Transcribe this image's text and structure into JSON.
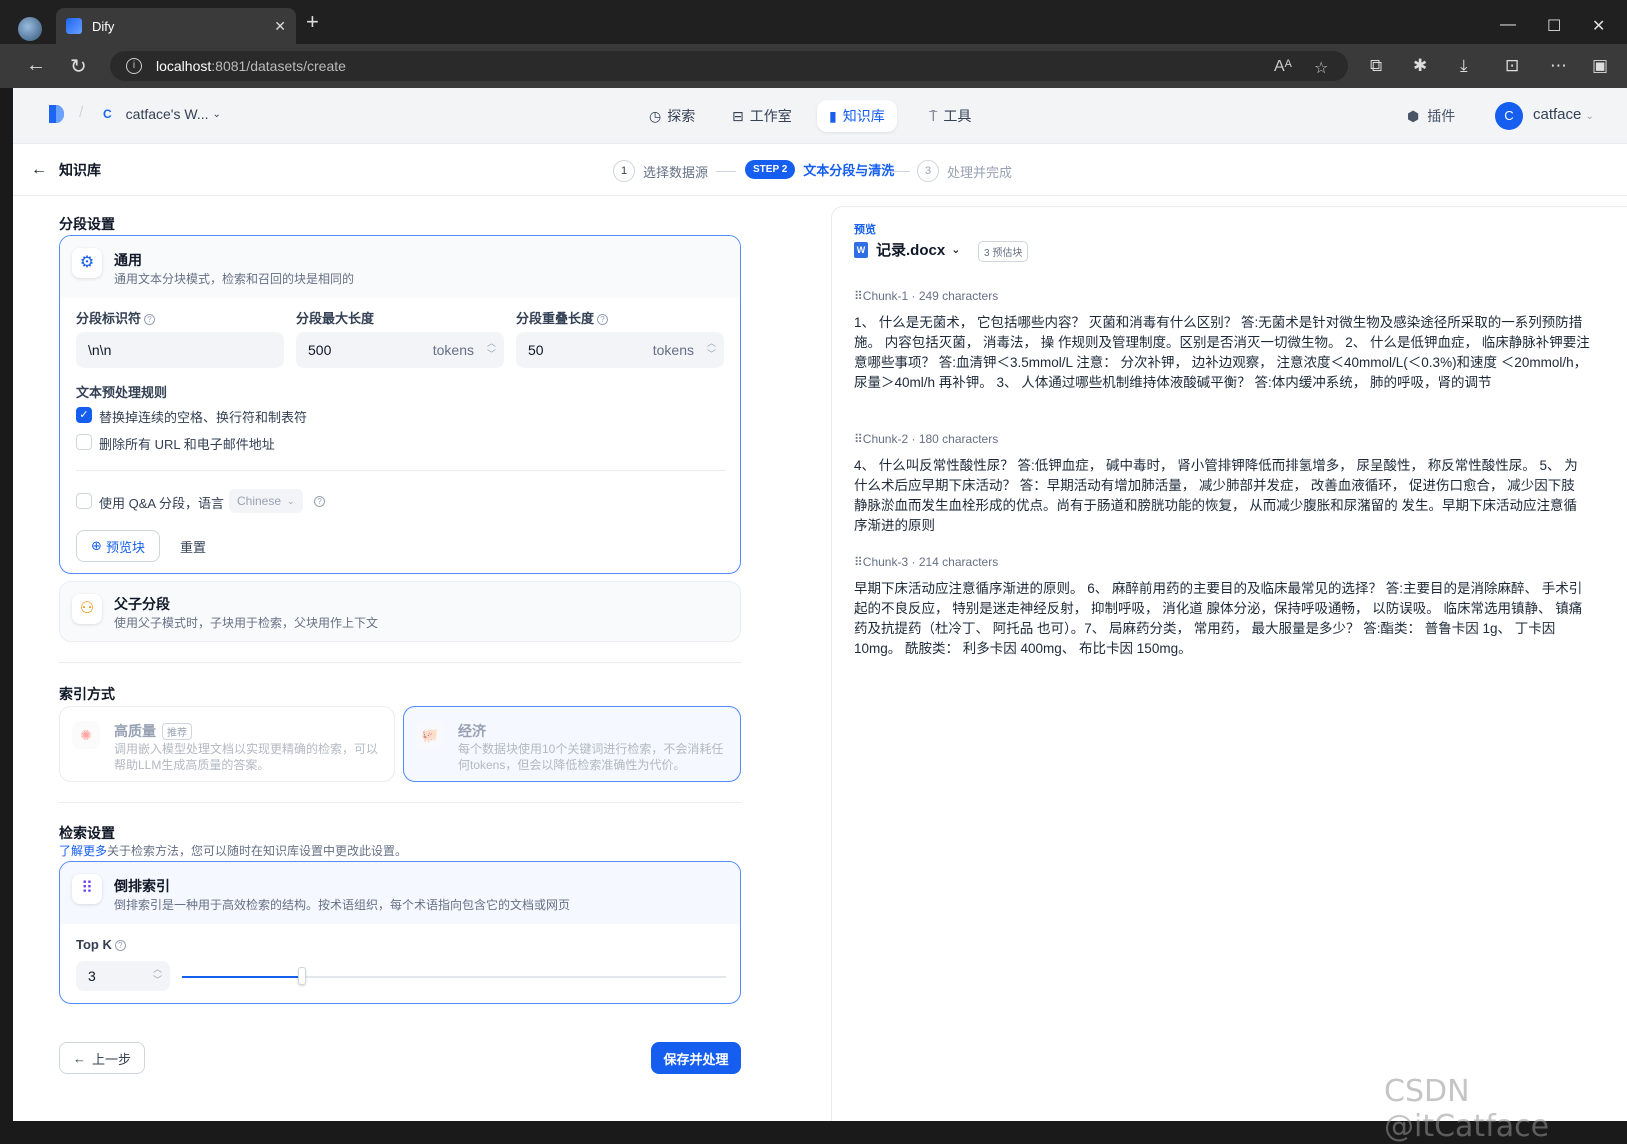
{
  "browser": {
    "tab_title": "Dify",
    "url_host": "localhost",
    "url_path": ":8081/datasets/create"
  },
  "topnav": {
    "workspace": "catface's W...",
    "workspace_initial": "C",
    "items": [
      {
        "label": "探索",
        "icon": "compass-icon"
      },
      {
        "label": "工作室",
        "icon": "robot-icon"
      },
      {
        "label": "知识库",
        "icon": "book-icon"
      },
      {
        "label": "工具",
        "icon": "tool-icon"
      }
    ],
    "plugin_label": "插件",
    "user_initial": "C",
    "user_name": "catface"
  },
  "stepbar": {
    "back_label": "知识库",
    "steps": [
      {
        "num": "1",
        "label": "选择数据源"
      },
      {
        "num": "STEP 2",
        "label": "文本分段与清洗"
      },
      {
        "num": "3",
        "label": "处理并完成"
      }
    ]
  },
  "segment": {
    "title": "分段设置",
    "general": {
      "title": "通用",
      "desc": "通用文本分块模式，检索和召回的块是相同的"
    },
    "identifier_label": "分段标识符",
    "identifier_value": "\\n\\n",
    "maxlen_label": "分段最大长度",
    "maxlen_value": "500",
    "overlap_label": "分段重叠长度",
    "overlap_value": "50",
    "unit": "tokens",
    "rules_label": "文本预处理规则",
    "rule1": "替换掉连续的空格、换行符和制表符",
    "rule2": "删除所有 URL 和电子邮件地址",
    "qa_label": "使用 Q&A 分段，语言",
    "qa_lang": "Chinese",
    "preview_btn": "预览块",
    "reset_btn": "重置",
    "parent": {
      "title": "父子分段",
      "desc": "使用父子模式时，子块用于检索，父块用作上下文"
    }
  },
  "index": {
    "title": "索引方式",
    "hq": {
      "title": "高质量",
      "tag": "推荐",
      "desc": "调用嵌入模型处理文档以实现更精确的检索，可以帮助LLM生成高质量的答案。"
    },
    "eco": {
      "title": "经济",
      "desc": "每个数据块使用10个关键词进行检索，不会消耗任何tokens，但会以降低检索准确性为代价。"
    }
  },
  "retrieval": {
    "title": "检索设置",
    "learn_more": "了解更多",
    "desc": "关于检索方法，您可以随时在知识库设置中更改此设置。",
    "inv": {
      "title": "倒排索引",
      "desc": "倒排索引是一种用于高效检索的结构。按术语组织，每个术语指向包含它的文档或网页"
    },
    "topk_label": "Top K",
    "topk_value": "3",
    "topk_level": 0.22
  },
  "footer": {
    "prev": "上一步",
    "save": "保存并处理"
  },
  "preview": {
    "label": "预览",
    "file": "记录.docx",
    "badge": "3 预估块",
    "chunks": [
      {
        "head": "Chunk-1 · 249 characters",
        "body": "1、 什么是无菌术， 它包括哪些内容？ 灭菌和消毒有什么区别？ 答:无菌术是针对微生物及感染途径所采取的一系列预防措施。 内容包括灭菌， 消毒法， 操 作规则及管理制度。区别是否消灭一切微生物。 2、 什么是低钾血症， 临床静脉补钾要注意哪些事项？ 答:血清钾＜3.5mmol/L 注意： 分次补钾， 边补边观察， 注意浓度＜40mmol/L(＜0.3%)和速度 ＜20mmol/h， 尿量＞40ml/h 再补钾。 3、 人体通过哪些机制维持体液酸碱平衡？ 答:体内缓冲系统， 肺的呼吸，肾的调节"
      },
      {
        "head": "Chunk-2 · 180 characters",
        "body": "4、 什么叫反常性酸性尿？ 答:低钾血症， 碱中毒时， 肾小管排钾降低而排氢增多， 尿呈酸性， 称反常性酸性尿。 5、 为什么术后应早期下床活动？ 答：早期活动有增加肺活量， 减少肺部并发症， 改善血液循环， 促进伤口愈合， 减少因下肢 静脉淤血而发生血栓形成的优点。尚有于肠道和膀胱功能的恢复， 从而减少腹胀和尿潴留的 发生。早期下床活动应注意循序渐进的原则"
      },
      {
        "head": "Chunk-3 · 214 characters",
        "body": "早期下床活动应注意循序渐进的原则。 6、 麻醉前用药的主要目的及临床最常见的选择？ 答:主要目的是消除麻醉、 手术引起的不良反应， 特别是迷走神经反射， 抑制呼吸， 消化道 腺体分泌，保持呼吸通畅， 以防误吸。 临床常选用镇静、 镇痛药及抗提药（杜冷丁、 阿托品 也可）。7、 局麻药分类， 常用药， 最大服量是多少？ 答:酯类： 普鲁卡因 1g、 丁卡因 10mg。 酰胺类： 利多卡因 400mg、 布比卡因 150mg。"
      }
    ]
  },
  "watermark": "CSDN @itCatface"
}
